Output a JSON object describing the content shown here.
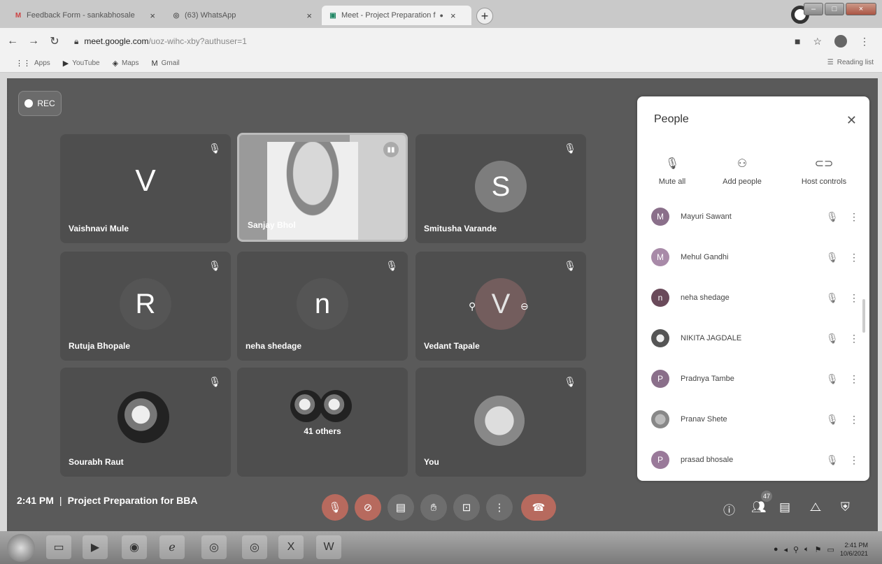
{
  "tabs": [
    {
      "label": "Feedback Form - sankabhosale",
      "icon": "gmail-icon"
    },
    {
      "label": "(63) WhatsApp",
      "icon": "whatsapp-icon"
    },
    {
      "label": "Meet - Project Preparation f",
      "icon": "meet-icon"
    }
  ],
  "address": {
    "host": "meet.google.com",
    "path": "/uoz-wihc-xby?authuser=1"
  },
  "bookmarks": [
    "Apps",
    "YouTube",
    "Maps",
    "Gmail"
  ],
  "reading_list": "Reading list",
  "rec_label": "REC",
  "tiles": [
    {
      "name": "Vaishnavi Mule",
      "initial": "V"
    },
    {
      "name": "Sanjay Bhol",
      "initial": ""
    },
    {
      "name": "Smitusha Varande",
      "initial": "S"
    },
    {
      "name": "Rutuja Bhopale",
      "initial": "R"
    },
    {
      "name": "neha shedage",
      "initial": "n"
    },
    {
      "name": "Vedant Tapale",
      "initial": "V"
    },
    {
      "name": "Sourabh Raut",
      "initial": ""
    },
    {
      "name": "41 others",
      "initial": ""
    },
    {
      "name": "You",
      "initial": ""
    }
  ],
  "meeting": {
    "time": "2:41 PM",
    "separator": "|",
    "title": "Project Preparation for BBA"
  },
  "people_badge": "47",
  "panel": {
    "title": "People",
    "actions": {
      "mute_all": "Mute all",
      "add_people": "Add people",
      "host_controls": "Host controls"
    },
    "participants": [
      {
        "name": "Mayuri Sawant",
        "initial": "M"
      },
      {
        "name": "Mehul Gandhi",
        "initial": "M"
      },
      {
        "name": "neha shedage",
        "initial": "n"
      },
      {
        "name": "NIKITA JAGDALE",
        "initial": ""
      },
      {
        "name": "Pradnya Tambe",
        "initial": "P"
      },
      {
        "name": "Pranav Shete",
        "initial": ""
      },
      {
        "name": "prasad bhosale",
        "initial": "P"
      }
    ]
  },
  "taskbar": {
    "time": "2:41 PM",
    "date": "10/6/2021"
  }
}
